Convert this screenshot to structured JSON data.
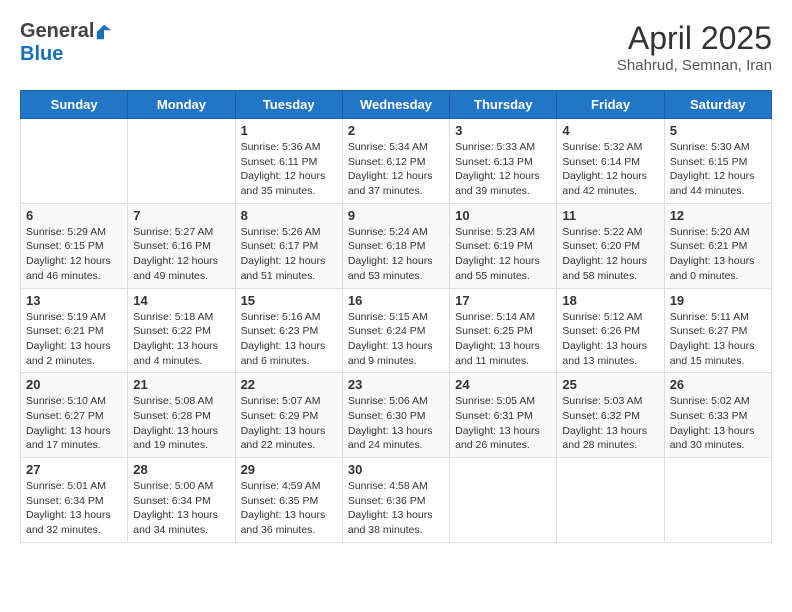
{
  "header": {
    "logo_general": "General",
    "logo_blue": "Blue",
    "month": "April 2025",
    "location": "Shahrud, Semnan, Iran"
  },
  "weekdays": [
    "Sunday",
    "Monday",
    "Tuesday",
    "Wednesday",
    "Thursday",
    "Friday",
    "Saturday"
  ],
  "weeks": [
    [
      {
        "day": "",
        "info": ""
      },
      {
        "day": "",
        "info": ""
      },
      {
        "day": "1",
        "info": "Sunrise: 5:36 AM\nSunset: 6:11 PM\nDaylight: 12 hours and 35 minutes."
      },
      {
        "day": "2",
        "info": "Sunrise: 5:34 AM\nSunset: 6:12 PM\nDaylight: 12 hours and 37 minutes."
      },
      {
        "day": "3",
        "info": "Sunrise: 5:33 AM\nSunset: 6:13 PM\nDaylight: 12 hours and 39 minutes."
      },
      {
        "day": "4",
        "info": "Sunrise: 5:32 AM\nSunset: 6:14 PM\nDaylight: 12 hours and 42 minutes."
      },
      {
        "day": "5",
        "info": "Sunrise: 5:30 AM\nSunset: 6:15 PM\nDaylight: 12 hours and 44 minutes."
      }
    ],
    [
      {
        "day": "6",
        "info": "Sunrise: 5:29 AM\nSunset: 6:15 PM\nDaylight: 12 hours and 46 minutes."
      },
      {
        "day": "7",
        "info": "Sunrise: 5:27 AM\nSunset: 6:16 PM\nDaylight: 12 hours and 49 minutes."
      },
      {
        "day": "8",
        "info": "Sunrise: 5:26 AM\nSunset: 6:17 PM\nDaylight: 12 hours and 51 minutes."
      },
      {
        "day": "9",
        "info": "Sunrise: 5:24 AM\nSunset: 6:18 PM\nDaylight: 12 hours and 53 minutes."
      },
      {
        "day": "10",
        "info": "Sunrise: 5:23 AM\nSunset: 6:19 PM\nDaylight: 12 hours and 55 minutes."
      },
      {
        "day": "11",
        "info": "Sunrise: 5:22 AM\nSunset: 6:20 PM\nDaylight: 12 hours and 58 minutes."
      },
      {
        "day": "12",
        "info": "Sunrise: 5:20 AM\nSunset: 6:21 PM\nDaylight: 13 hours and 0 minutes."
      }
    ],
    [
      {
        "day": "13",
        "info": "Sunrise: 5:19 AM\nSunset: 6:21 PM\nDaylight: 13 hours and 2 minutes."
      },
      {
        "day": "14",
        "info": "Sunrise: 5:18 AM\nSunset: 6:22 PM\nDaylight: 13 hours and 4 minutes."
      },
      {
        "day": "15",
        "info": "Sunrise: 5:16 AM\nSunset: 6:23 PM\nDaylight: 13 hours and 6 minutes."
      },
      {
        "day": "16",
        "info": "Sunrise: 5:15 AM\nSunset: 6:24 PM\nDaylight: 13 hours and 9 minutes."
      },
      {
        "day": "17",
        "info": "Sunrise: 5:14 AM\nSunset: 6:25 PM\nDaylight: 13 hours and 11 minutes."
      },
      {
        "day": "18",
        "info": "Sunrise: 5:12 AM\nSunset: 6:26 PM\nDaylight: 13 hours and 13 minutes."
      },
      {
        "day": "19",
        "info": "Sunrise: 5:11 AM\nSunset: 6:27 PM\nDaylight: 13 hours and 15 minutes."
      }
    ],
    [
      {
        "day": "20",
        "info": "Sunrise: 5:10 AM\nSunset: 6:27 PM\nDaylight: 13 hours and 17 minutes."
      },
      {
        "day": "21",
        "info": "Sunrise: 5:08 AM\nSunset: 6:28 PM\nDaylight: 13 hours and 19 minutes."
      },
      {
        "day": "22",
        "info": "Sunrise: 5:07 AM\nSunset: 6:29 PM\nDaylight: 13 hours and 22 minutes."
      },
      {
        "day": "23",
        "info": "Sunrise: 5:06 AM\nSunset: 6:30 PM\nDaylight: 13 hours and 24 minutes."
      },
      {
        "day": "24",
        "info": "Sunrise: 5:05 AM\nSunset: 6:31 PM\nDaylight: 13 hours and 26 minutes."
      },
      {
        "day": "25",
        "info": "Sunrise: 5:03 AM\nSunset: 6:32 PM\nDaylight: 13 hours and 28 minutes."
      },
      {
        "day": "26",
        "info": "Sunrise: 5:02 AM\nSunset: 6:33 PM\nDaylight: 13 hours and 30 minutes."
      }
    ],
    [
      {
        "day": "27",
        "info": "Sunrise: 5:01 AM\nSunset: 6:34 PM\nDaylight: 13 hours and 32 minutes."
      },
      {
        "day": "28",
        "info": "Sunrise: 5:00 AM\nSunset: 6:34 PM\nDaylight: 13 hours and 34 minutes."
      },
      {
        "day": "29",
        "info": "Sunrise: 4:59 AM\nSunset: 6:35 PM\nDaylight: 13 hours and 36 minutes."
      },
      {
        "day": "30",
        "info": "Sunrise: 4:58 AM\nSunset: 6:36 PM\nDaylight: 13 hours and 38 minutes."
      },
      {
        "day": "",
        "info": ""
      },
      {
        "day": "",
        "info": ""
      },
      {
        "day": "",
        "info": ""
      }
    ]
  ]
}
